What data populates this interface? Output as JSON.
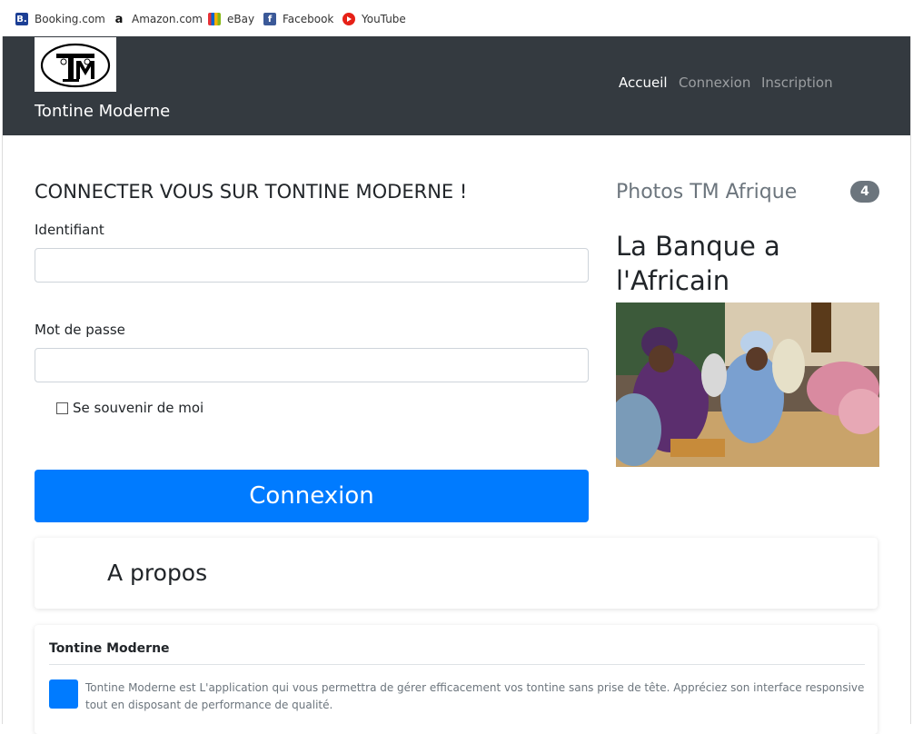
{
  "bookmarks": [
    {
      "label": "Booking.com",
      "icon": "booking-icon",
      "glyph": "B."
    },
    {
      "label": "Amazon.com",
      "icon": "amazon-icon",
      "glyph": "a"
    },
    {
      "label": "eBay",
      "icon": "ebay-icon",
      "glyph": ""
    },
    {
      "label": "Facebook",
      "icon": "facebook-icon",
      "glyph": "f"
    },
    {
      "label": "YouTube",
      "icon": "youtube-icon",
      "glyph": ""
    }
  ],
  "navbar": {
    "brand": "Tontine Moderne",
    "logo_text": "TM",
    "links": [
      {
        "label": "Accueil",
        "active": true
      },
      {
        "label": "Connexion",
        "active": false
      },
      {
        "label": "Inscription",
        "active": false
      }
    ]
  },
  "login": {
    "title": "CONNECTER VOUS SUR TONTINE MODERNE !",
    "username_label": "Identifiant",
    "username_value": "",
    "password_label": "Mot de passe",
    "password_value": "",
    "remember_label": "Se souvenir de moi",
    "remember_checked": false,
    "submit_label": "Connexion"
  },
  "sidebar": {
    "photos_title": "Photos TM Afrique",
    "photos_count": "4",
    "headline": "La Banque a l'Africain"
  },
  "about": {
    "title": "A propos",
    "card_title": "Tontine Moderne",
    "description": "Tontine Moderne est L'application qui vous permettra de gérer efficacement vos tontine sans prise de tête. Appréciez son interface responsive tout en disposant de performance de qualité."
  },
  "colors": {
    "navbar_bg": "#343a40",
    "primary": "#007bff",
    "muted": "#6c757d"
  }
}
